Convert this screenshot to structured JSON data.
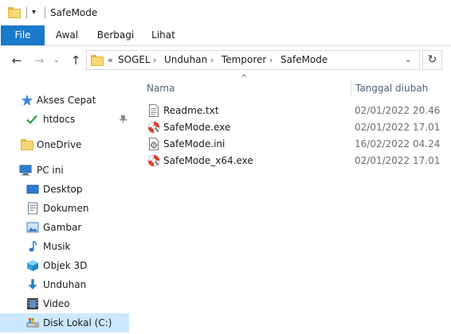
{
  "window": {
    "title": "SafeMode",
    "quick_access_arrow": "▾",
    "faded_text": "́’ ́ ́"
  },
  "ribbon": {
    "tabs": [
      "File",
      "Awal",
      "Berbagi",
      "Lihat"
    ]
  },
  "address": {
    "overflow": "«",
    "path": [
      "SOGEL",
      "Unduhan",
      "Temporer",
      "SafeMode"
    ],
    "separator": "›"
  },
  "nav": {
    "back_glyph": "←",
    "forward_glyph": "→",
    "recent_glyph": "⌄",
    "up_glyph": "↑",
    "dropdown_glyph": "⌄",
    "refresh_glyph": "↻"
  },
  "navpane": {
    "quick_access": {
      "label": "Akses Cepat",
      "icon": "star-icon"
    },
    "pinned": [
      {
        "label": "htdocs",
        "icon": "check-icon",
        "pinned": true
      }
    ],
    "onedrive": {
      "label": "OneDrive",
      "icon": "folder-icon"
    },
    "this_pc": {
      "label": "PC ini",
      "icon": "pc-icon"
    },
    "pc_items": [
      {
        "label": "Desktop",
        "icon": "desktop-icon"
      },
      {
        "label": "Dokumen",
        "icon": "document-icon"
      },
      {
        "label": "Gambar",
        "icon": "picture-icon"
      },
      {
        "label": "Musik",
        "icon": "music-icon"
      },
      {
        "label": "Objek 3D",
        "icon": "cube-icon"
      },
      {
        "label": "Unduhan",
        "icon": "download-icon"
      },
      {
        "label": "Video",
        "icon": "video-icon"
      },
      {
        "label": "Disk Lokal (C:)",
        "icon": "drive-icon"
      }
    ],
    "pin_glyph": "📌"
  },
  "content": {
    "sort_indicator": "^",
    "columns": {
      "name": "Nama",
      "date": "Tanggal diubah"
    },
    "files": [
      {
        "name": "Readme.txt",
        "date": "02/01/2022 20.46",
        "icon": "text-file-icon"
      },
      {
        "name": "SafeMode.exe",
        "date": "02/01/2022 17.01",
        "icon": "lifebuoy-icon"
      },
      {
        "name": "SafeMode.ini",
        "date": "16/02/2022 04.24",
        "icon": "config-file-icon"
      },
      {
        "name": "SafeMode_x64.exe",
        "date": "02/01/2022 17.01",
        "icon": "lifebuoy-icon"
      }
    ]
  },
  "colors": {
    "file_tab": "#1979ca",
    "selected_bg": "#cce8ff",
    "header_text": "#4c607a",
    "folder": "#f8d775"
  }
}
